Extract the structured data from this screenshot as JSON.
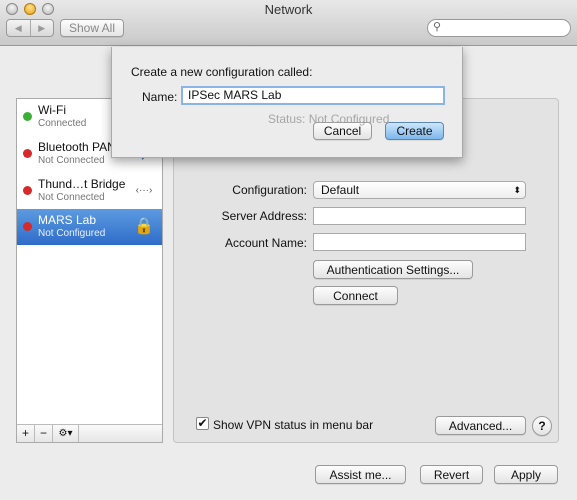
{
  "window": {
    "title": "Network",
    "show_all": "Show All",
    "back": "◀",
    "forward": "▶",
    "search_placeholder": ""
  },
  "sidebar": {
    "items": [
      {
        "name": "Wi-Fi",
        "status": "Connected",
        "color": "#3cb034",
        "icon": "wifi-icon",
        "glyph": "◠"
      },
      {
        "name": "Bluetooth PAN",
        "status": "Not Connected",
        "color": "#d62a2a",
        "icon": "bluetooth-icon",
        "glyph": "ᛒ"
      },
      {
        "name": "Thund…t Bridge",
        "status": "Not Connected",
        "color": "#d62a2a",
        "icon": "thunderbolt-bridge-icon",
        "glyph": "‹···›"
      },
      {
        "name": "MARS Lab",
        "status": "Not Configured",
        "color": "#d62a2a",
        "icon": "lock-icon",
        "glyph": "🔒"
      }
    ],
    "add": "+",
    "remove": "−",
    "gear": "⚙▾"
  },
  "panel": {
    "status": "Status: Not Configured",
    "configuration_label": "Configuration:",
    "configuration_value": "Default",
    "server_label": "Server Address:",
    "server_value": "",
    "account_label": "Account Name:",
    "account_value": "",
    "auth_button": "Authentication Settings...",
    "connect_button": "Connect",
    "show_vpn_label": "Show VPN status in menu bar",
    "show_vpn_checked": true,
    "advanced_button": "Advanced...",
    "help": "?"
  },
  "footer": {
    "assist": "Assist me...",
    "revert": "Revert",
    "apply": "Apply"
  },
  "sheet": {
    "prompt": "Create a new configuration called:",
    "name_label": "Name:",
    "name_value": "IPSec MARS Lab",
    "cancel": "Cancel",
    "create": "Create"
  }
}
